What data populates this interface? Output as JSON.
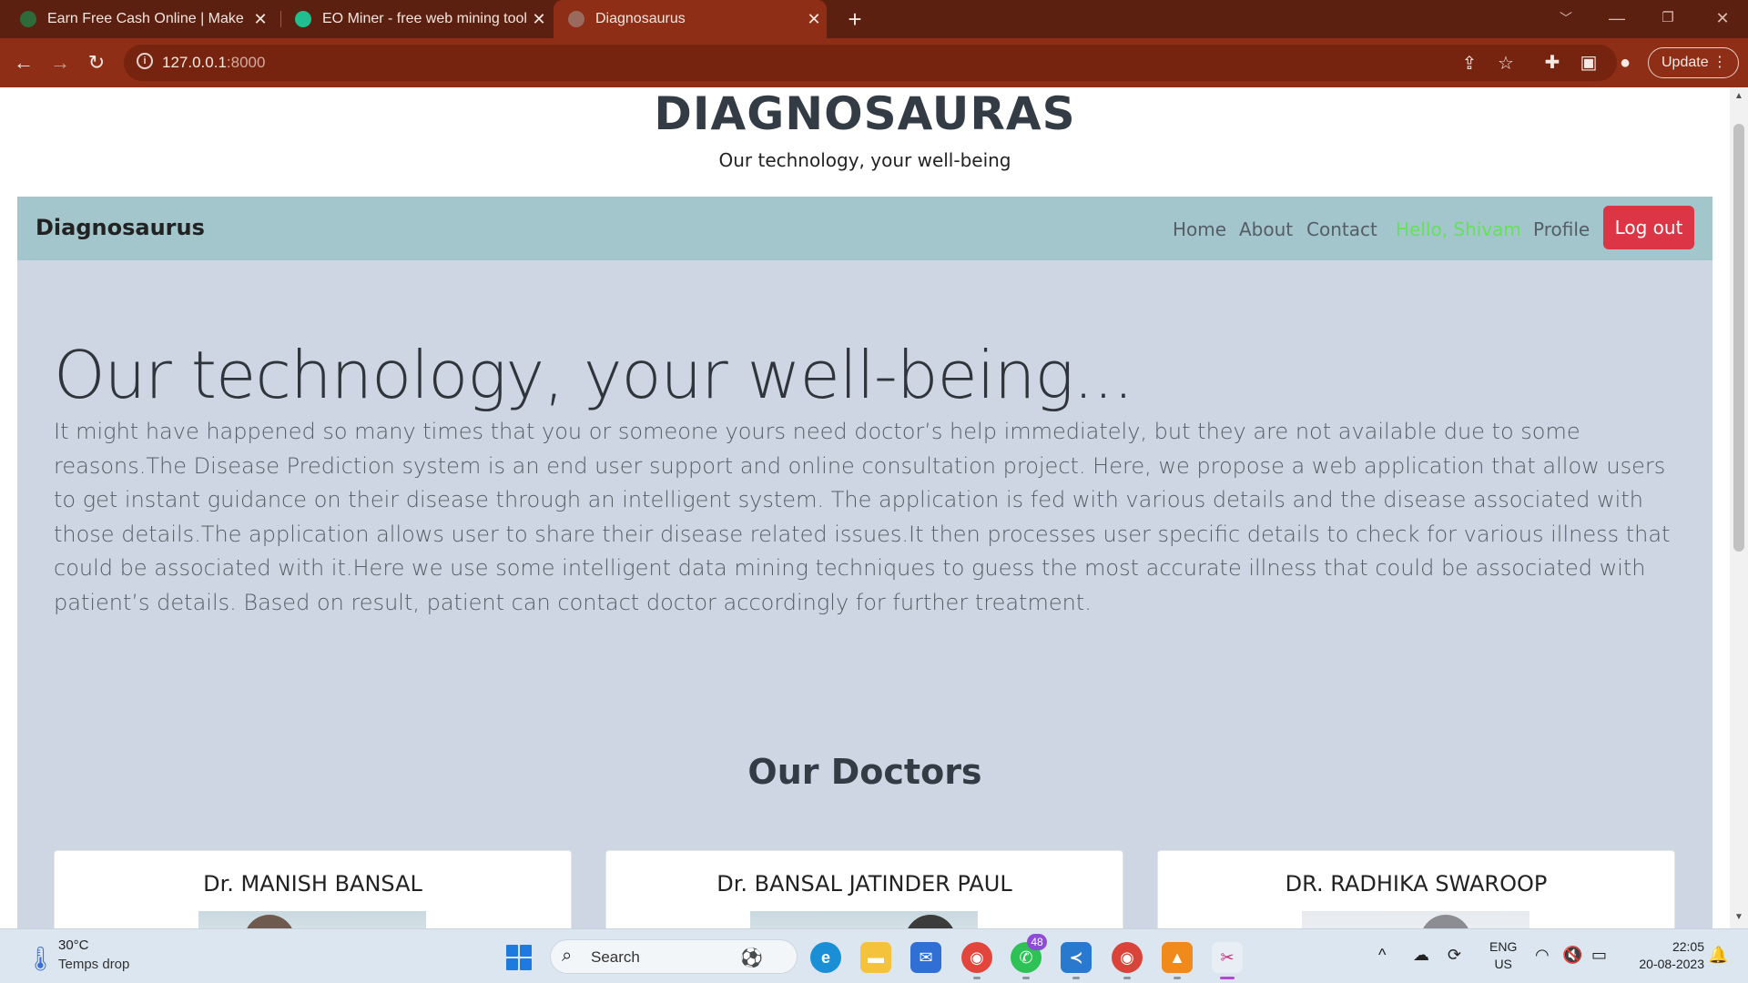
{
  "browser": {
    "tabs": [
      {
        "title": "Earn Free Cash Online | Make Ext",
        "color": "#2d6b3a"
      },
      {
        "title": "EO Miner - free web mining tool",
        "color": "#1fbf8f"
      },
      {
        "title": "Diagnosaurus",
        "color": "#9b6a5e"
      }
    ],
    "url_host": "127.0.0.1",
    "url_port": ":8000",
    "update_label": "Update"
  },
  "site": {
    "title": "DIAGNOSAURAS",
    "subtitle": "Our technology, your well-being",
    "brand": "Diagnosaurus",
    "nav": {
      "home": "Home",
      "about": "About",
      "contact": "Contact",
      "hello": "Hello, Shivam",
      "profile": "Profile",
      "logout": "Log out"
    },
    "hero": {
      "heading": "Our technology, your well-being...",
      "lead": "It might have happened so many times that you or someone yours need doctor’s help immediately, but they are not available due to some reasons.The Disease Prediction system is an end user support and online consultation project. Here, we propose a web application that allow users to get instant guidance on their disease through an intelligent system. The application is fed with various details and the disease associated with those details.The application allows user to share their disease related issues.It then processes user specific details to check for various illness that could be associated with it.Here we use some intelligent data mining techniques to guess the most accurate illness that could be associated with patient’s details. Based on result, patient can contact doctor accordingly for further treatment."
    },
    "doctors_heading": "Our Doctors",
    "doctors": [
      {
        "name": "Dr. MANISH BANSAL"
      },
      {
        "name": "Dr. BANSAL JATINDER PAUL"
      },
      {
        "name": "DR. RADHIKA SWAROOP"
      }
    ]
  },
  "taskbar": {
    "weather_temp": "30°C",
    "weather_desc": "Temps drop",
    "search_label": "Search",
    "whatsapp_badge": "48",
    "lang": "ENG",
    "region": "US",
    "time": "22:05",
    "date": "20-08-2023"
  }
}
